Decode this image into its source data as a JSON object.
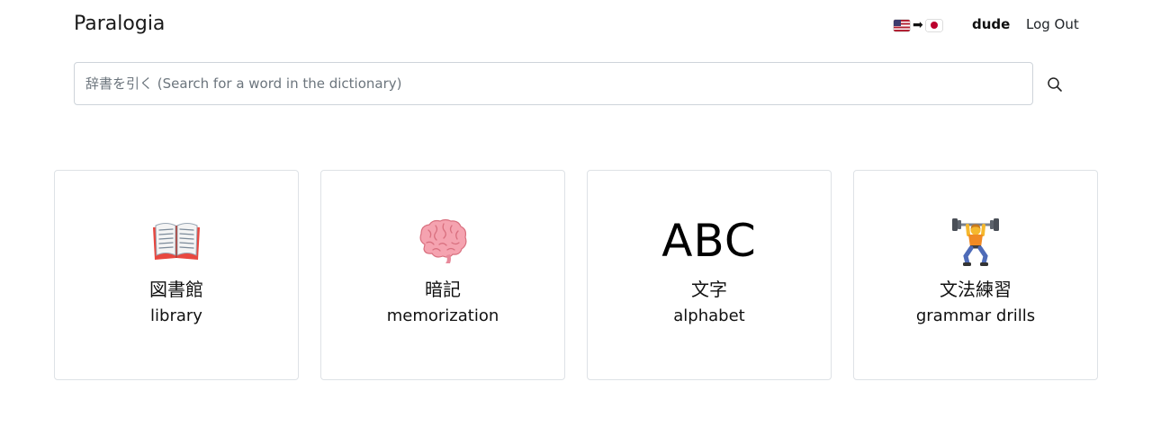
{
  "header": {
    "brand": "Paralogia",
    "language_pair": {
      "from": "us-flag-icon",
      "arrow": "➡",
      "to": "japan-flag-icon"
    },
    "username": "dude",
    "logout_label": "Log Out"
  },
  "search": {
    "placeholder": "辞書を引く (Search for a word in the dictionary)",
    "value": "",
    "button_icon": "search-icon"
  },
  "cards": [
    {
      "icon": "open-book-icon",
      "jp": "図書館",
      "en": "library"
    },
    {
      "icon": "brain-icon",
      "jp": "暗記",
      "en": "memorization"
    },
    {
      "icon": "abc-text-icon",
      "icon_text": "ABC",
      "jp": "文字",
      "en": "alphabet"
    },
    {
      "icon": "weightlifter-icon",
      "jp": "文法練習",
      "en": "grammar drills"
    }
  ]
}
